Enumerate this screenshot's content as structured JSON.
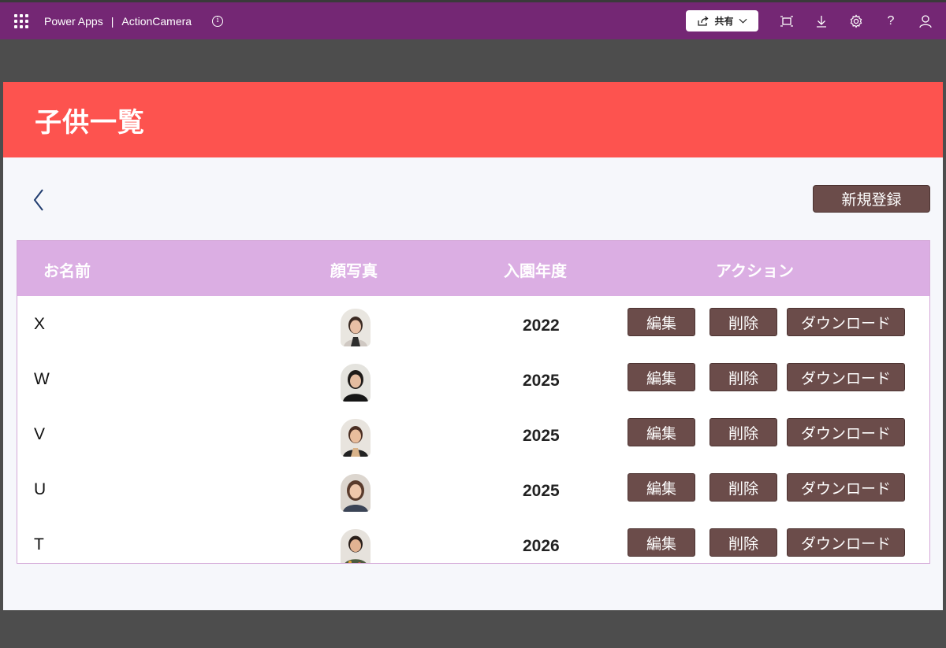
{
  "topbar": {
    "app_name": "Power Apps",
    "separator": "|",
    "app_title": "ActionCamera",
    "share_label": "共有",
    "icons": [
      "waffle-icon",
      "info-icon",
      "share-icon",
      "chevron-down-icon",
      "fit-screen-icon",
      "download-icon",
      "settings-icon",
      "help-icon",
      "user-icon"
    ],
    "help_glyph": "?"
  },
  "header": {
    "title": "子供一覧",
    "new_button": "新規登録"
  },
  "table": {
    "columns": [
      "お名前",
      "顔写真",
      "入園年度",
      "アクション"
    ],
    "rows": [
      {
        "name": "X",
        "year": "2022",
        "photo": "child-photo-x"
      },
      {
        "name": "W",
        "year": "2025",
        "photo": "child-photo-w"
      },
      {
        "name": "V",
        "year": "2025",
        "photo": "child-photo-v"
      },
      {
        "name": "U",
        "year": "2025",
        "photo": "child-photo-u"
      },
      {
        "name": "T",
        "year": "2026",
        "photo": "child-photo-t"
      }
    ],
    "actions": {
      "edit": "編集",
      "delete": "削除",
      "download": "ダウンロード"
    }
  },
  "colors": {
    "topbar": "#742774",
    "header": "#fd534f",
    "table_header": "#dbaee3",
    "button": "#6b4c4a",
    "background": "#f6f7fb"
  }
}
